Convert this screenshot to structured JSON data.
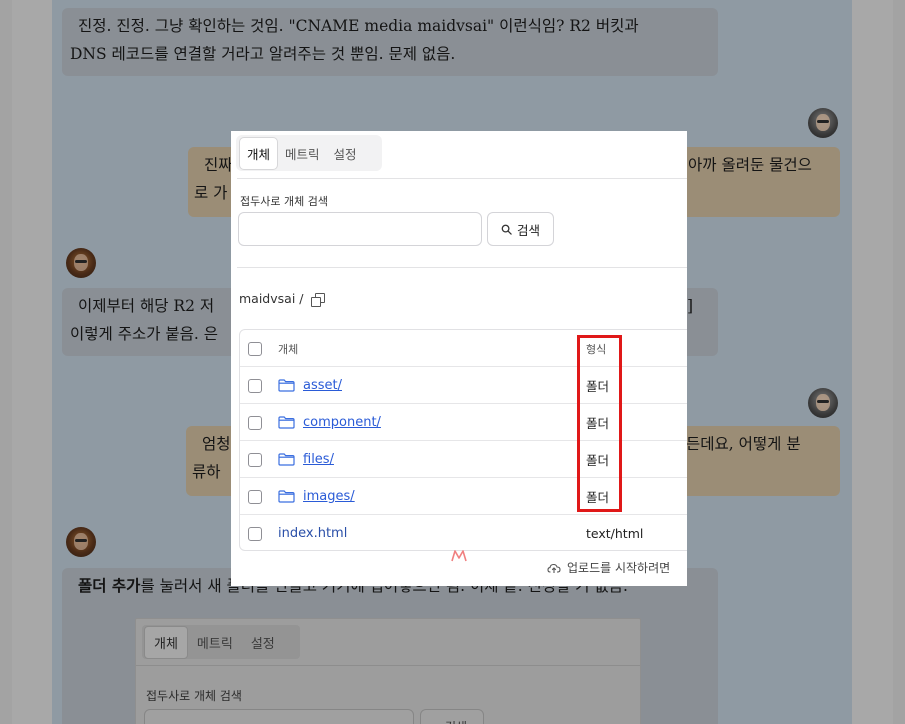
{
  "chat": {
    "msg1": {
      "line1": "진정. 진정. 그냥 확인하는 것임. \"CNAME media maidvsai\" 이런식임? R2 버킷과",
      "line2": "DNS 레코드를 연결할 거라고 알려주는 것 뿐임. 문제 없음."
    },
    "msg2": {
      "line1a": "진짜",
      "line1b": "아까 올려둔 물건으",
      "line2": "로 가"
    },
    "msg3": {
      "line1a": "이제부터 해당 R2 저",
      "line1b": "]",
      "line2": "이렇게 주소가 붙음. 은"
    },
    "msg4": {
      "line1a": "엄청",
      "line1b": "든데요, 어떻게 분",
      "line2": "류하"
    },
    "msg5": {
      "bold": "폴더 추가",
      "rest": "를 눌러서 새 폴더를 만들고 거기에 집어넣으면 됨. 이제 끝. 진정할 거 없음."
    }
  },
  "modal": {
    "tabs": [
      {
        "label": "개체"
      },
      {
        "label": "메트릭"
      },
      {
        "label": "설정"
      }
    ],
    "search": {
      "label": "접두사로 개체 검색",
      "placeholder": "",
      "button": "검색"
    },
    "breadcrumb": "maidvsai /",
    "table": {
      "headers": {
        "name": "개체",
        "type": "형식"
      },
      "rows": [
        {
          "name": "asset/",
          "type": "폴더",
          "kind": "folder"
        },
        {
          "name": "component/",
          "type": "폴더",
          "kind": "folder"
        },
        {
          "name": "files/",
          "type": "폴더",
          "kind": "folder"
        },
        {
          "name": "images/",
          "type": "폴더",
          "kind": "folder"
        },
        {
          "name": "index.html",
          "type": "text/html",
          "kind": "file"
        }
      ]
    },
    "upload_hint": "업로드를 시작하려면",
    "logo_text": "M"
  },
  "mini": {
    "tabs": [
      {
        "label": "개체"
      },
      {
        "label": "메트릭"
      },
      {
        "label": "설정"
      }
    ],
    "search_label": "접두사로 개체 검색",
    "search_button": "검색"
  },
  "colors": {
    "highlight": "#e01818",
    "link": "#2a5bd7",
    "folder_icon": "#3b6fe0"
  },
  "icons": {
    "search": "search-icon",
    "copy": "copy-icon",
    "folder": "folder-icon",
    "upload": "cloud-upload-icon"
  }
}
